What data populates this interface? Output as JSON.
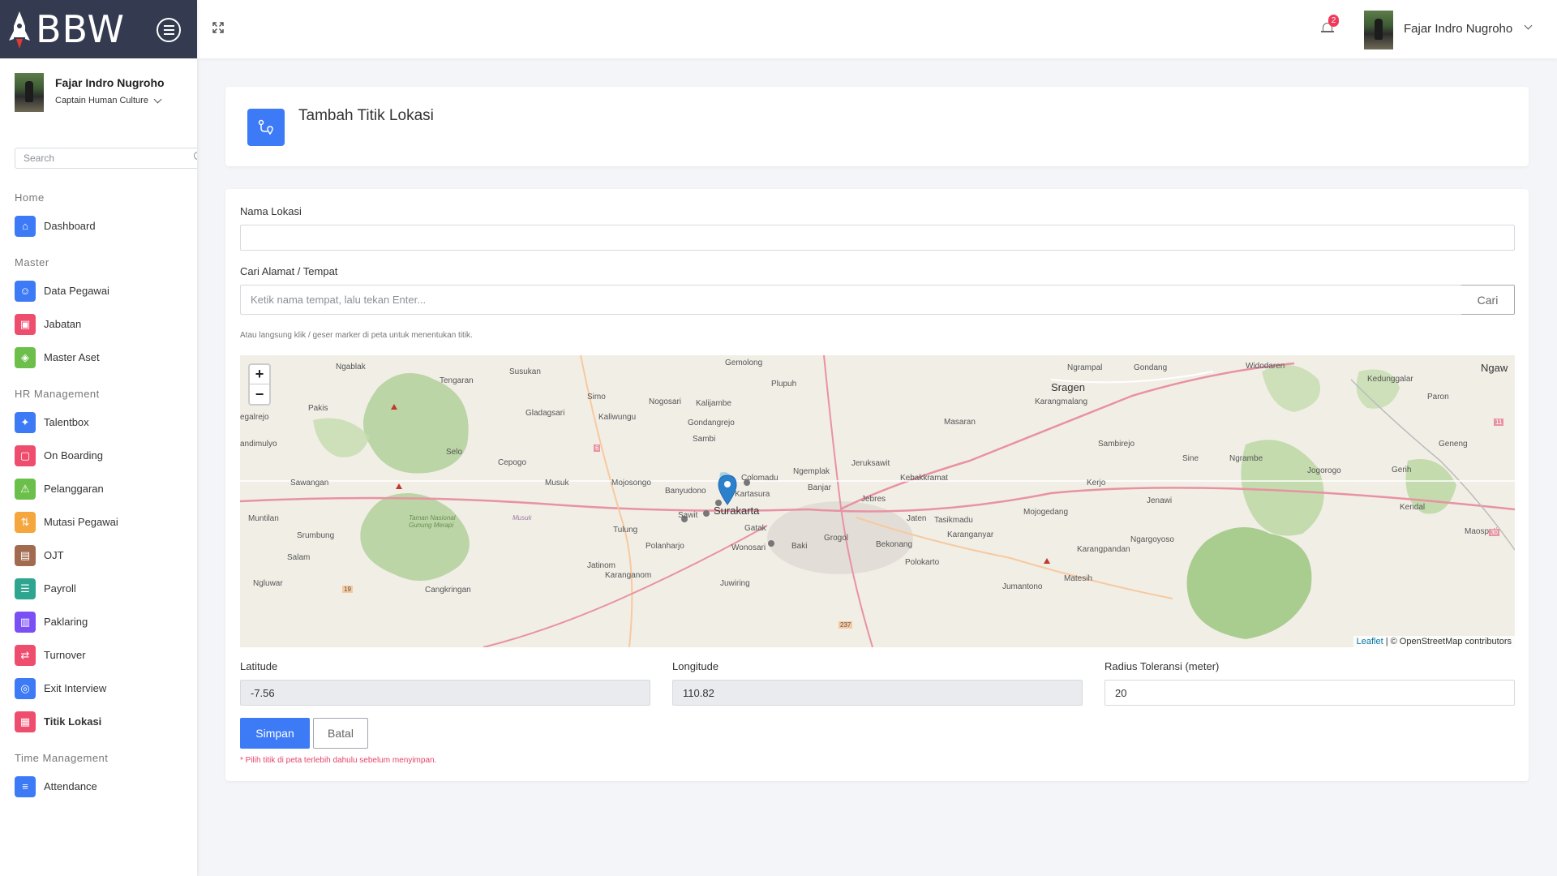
{
  "brand": {
    "name": "BBW"
  },
  "user": {
    "name": "Fajar Indro Nugroho",
    "role": "Captain Human Culture"
  },
  "sidebar": {
    "search_placeholder": "Search",
    "sections": {
      "home": "Home",
      "master": "Master",
      "hr": "HR Management",
      "time": "Time Management"
    },
    "items": {
      "dashboard": "Dashboard",
      "data_pegawai": "Data Pegawai",
      "jabatan": "Jabatan",
      "master_aset": "Master Aset",
      "talentbox": "Talentbox",
      "onboarding": "On Boarding",
      "pelanggaran": "Pelanggaran",
      "mutasi": "Mutasi Pegawai",
      "ojt": "OJT",
      "payroll": "Payroll",
      "paklaring": "Paklaring",
      "turnover": "Turnover",
      "exit_interview": "Exit Interview",
      "titik_lokasi": "Titik Lokasi",
      "attendance": "Attendance"
    },
    "colors": {
      "blue": "#3d7af5",
      "pink": "#ef4d6e",
      "green": "#6cbf4a",
      "orange": "#f5a63d",
      "brown": "#a26a4f",
      "teal": "#2ea58f",
      "purple": "#7a4ff5"
    }
  },
  "topbar": {
    "notification_count": "2",
    "user_name": "Fajar Indro Nugroho"
  },
  "page": {
    "title": "Tambah Titik Lokasi"
  },
  "form": {
    "nama_label": "Nama Lokasi",
    "nama_value": "",
    "cari_label": "Cari Alamat / Tempat",
    "cari_placeholder": "Ketik nama tempat, lalu tekan Enter...",
    "cari_button": "Cari",
    "hint": "Atau langsung klik / geser marker di peta untuk menentukan titik.",
    "lat_label": "Latitude",
    "lat_value": "-7.56",
    "lng_label": "Longitude",
    "lng_value": "110.82",
    "radius_label": "Radius Toleransi (meter)",
    "radius_value": "20",
    "save_button": "Simpan",
    "cancel_button": "Batal",
    "error": "* Pilih titik di peta terlebih dahulu sebelum menyimpan."
  },
  "map": {
    "zoom_in": "+",
    "zoom_out": "−",
    "attribution_leaflet": "Leaflet",
    "attribution_rest": "| © OpenStreetMap contributors",
    "labels": {
      "surakarta": "Surakarta",
      "sragen": "Sragen",
      "gemolong": "Gemolong",
      "plupuh": "Plupuh",
      "ngrampal": "Ngrampal",
      "gondang": "Gondang",
      "widodaren": "Widodaren",
      "kedunggalar": "Kedunggalar",
      "ngaw": "Ngaw",
      "ngablak": "Ngablak",
      "tengaran": "Tengaran",
      "susukan": "Susukan",
      "simo": "Simo",
      "nogosari": "Nogosari",
      "kalijambe": "Kalijambe",
      "karangmalang": "Karangmalang",
      "paron": "Paron",
      "egalrejo": "egalrejo",
      "pakis": "Pakis",
      "gladagsari": "Gladagsari",
      "kaliwungu": "Kaliwungu",
      "gondangrejo": "Gondangrejo",
      "masaran": "Masaran",
      "andimulyo": "andimulyo",
      "sambi": "Sambi",
      "sambirejo": "Sambirejo",
      "geneng": "Geneng",
      "selo": "Selo",
      "cepogo": "Cepogo",
      "jeruksawit": "Jeruksawit",
      "sine": "Sine",
      "ngrambe": "Ngrambe",
      "jogorogo": "Jogorogo",
      "gerih": "Gerih",
      "ngemplak": "Ngemplak",
      "kebakkramat": "Kebakkramat",
      "sawangan": "Sawangan",
      "musuk": "Musuk",
      "mojosongo": "Mojosongo",
      "colomadu": "Colomadu",
      "banjar": "Banjar",
      "kartasura": "Kartasura",
      "banyudono": "Banyudono",
      "jebres": "Jebres",
      "kerjo": "Kerjo",
      "jenawi": "Jenawi",
      "kendal": "Kendal",
      "muntilan": "Muntilan",
      "sawit": "Sawit",
      "mojogedang": "Mojogedang",
      "jaten": "Jaten",
      "tasikmadu": "Tasikmadu",
      "srumbung": "Srumbung",
      "tulung": "Tulung",
      "gatak": "Gatak",
      "grogol": "Grogol",
      "karanganyar": "Karanganyar",
      "ngargoyoso": "Ngargoyoso",
      "maospati": "Maospati",
      "salam": "Salam",
      "polanharjo": "Polanharjo",
      "wonosari": "Wonosari",
      "baki": "Baki",
      "bekonang": "Bekonang",
      "karangpandan": "Karangpandan",
      "jatinom": "Jatinom",
      "polokarto": "Polokarto",
      "matesih": "Matesih",
      "ngluwar": "Ngluwar",
      "karanganom": "Karanganom",
      "juwiring": "Juwiring",
      "jumantono": "Jumantono",
      "cangkringan": "Cangkringan",
      "merapi": "Taman Nasional Gunung Merapi",
      "musuk2": "Musuk",
      "r6": "6",
      "r11": "11",
      "r30": "30",
      "r19": "19",
      "r237": "237"
    }
  }
}
